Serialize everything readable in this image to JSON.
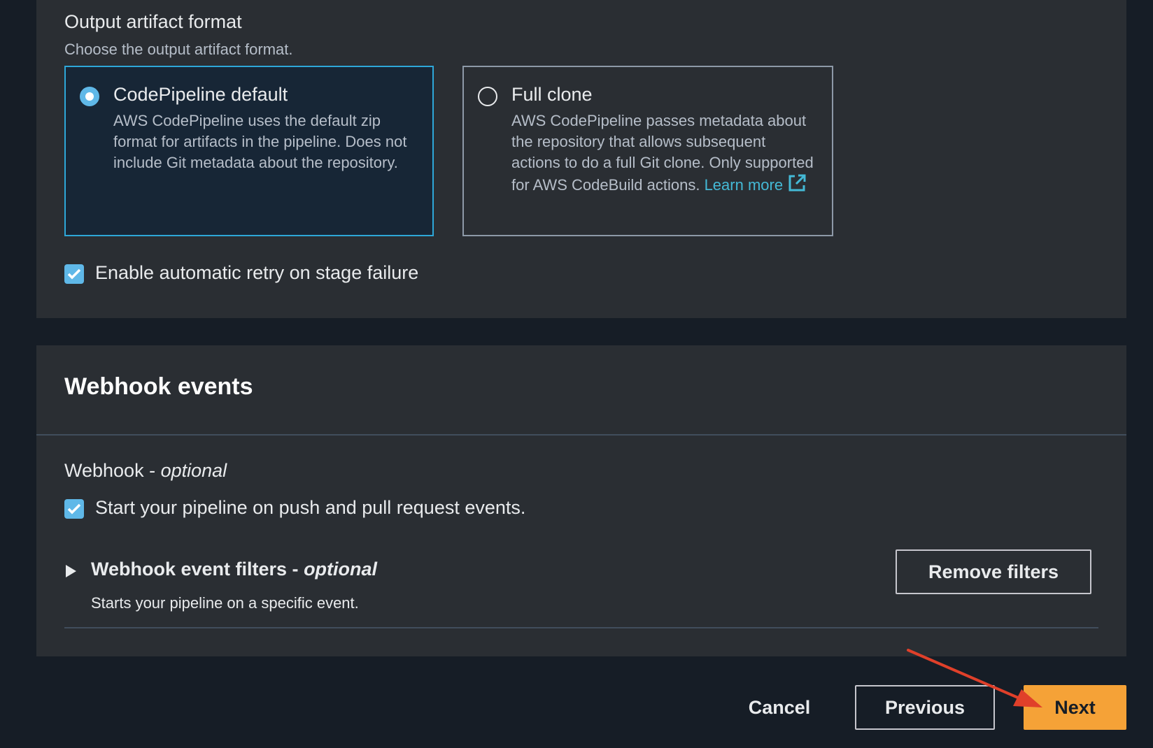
{
  "output_artifact": {
    "label": "Output artifact format",
    "description": "Choose the output artifact format.",
    "options": [
      {
        "title": "CodePipeline default",
        "description": "AWS CodePipeline uses the default zip format for artifacts in the pipeline. Does not include Git metadata about the repository.",
        "selected": true
      },
      {
        "title": "Full clone",
        "description": "AWS CodePipeline passes metadata about the repository that allows subsequent actions to do a full Git clone. Only supported for AWS CodeBuild actions.",
        "link_text": "Learn more",
        "link_icon": "external-link-icon",
        "selected": false
      }
    ]
  },
  "retry": {
    "label": "Enable automatic retry on stage failure",
    "checked": true
  },
  "webhook_events": {
    "title": "Webhook events",
    "webhook_label": "Webhook - ",
    "webhook_optional": "optional",
    "checkbox_label": "Start your pipeline on push and pull request events.",
    "checkbox_checked": true,
    "filters": {
      "title": "Webhook event filters - ",
      "optional": "optional",
      "description": "Starts your pipeline on a specific event.",
      "expanded": false
    },
    "remove_filters_label": "Remove filters"
  },
  "footer": {
    "cancel_label": "Cancel",
    "previous_label": "Previous",
    "next_label": "Next"
  },
  "colors": {
    "background": "#161d26",
    "panel": "#2a2e33",
    "accent": "#5fb8e8",
    "selected_tile_border": "#2ea7d8",
    "primary_button": "#f5a237",
    "annotation_arrow": "#e0402a"
  }
}
